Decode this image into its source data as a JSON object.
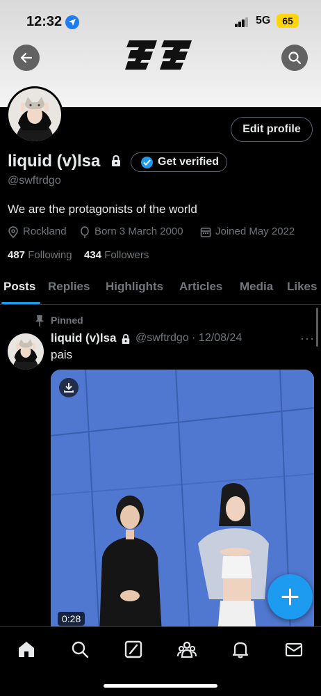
{
  "status_bar": {
    "time": "12:32",
    "network": "5G",
    "battery": "65"
  },
  "header": {
    "logo_text": "33",
    "back_icon": "arrow-left-icon",
    "search_icon": "search-icon"
  },
  "profile": {
    "name": "liquid (v)lsa",
    "handle": "@swftrdgo",
    "bio": "We are the protagonists of the world",
    "location": "Rockland",
    "birth": "Born 3 March 2000",
    "joined": "Joined May 2022",
    "following_count": "487",
    "following_label": "Following",
    "followers_count": "434",
    "followers_label": "Followers",
    "edit_label": "Edit profile",
    "verify_label": "Get verified"
  },
  "tabs": [
    {
      "label": "Posts",
      "active": true
    },
    {
      "label": "Replies"
    },
    {
      "label": "Highlights"
    },
    {
      "label": "Articles"
    },
    {
      "label": "Media"
    },
    {
      "label": "Likes"
    }
  ],
  "post": {
    "pinned_label": "Pinned",
    "name": "liquid (v)lsa",
    "handle_date": "@swftrdgo · 12/08/24",
    "text": "pais",
    "duration": "0:28",
    "more": "···"
  },
  "colors": {
    "accent": "#1d9bf0",
    "background": "#000000",
    "muted": "#71767b"
  },
  "bottom_nav": [
    "home-icon",
    "search-icon",
    "grok-icon",
    "communities-icon",
    "notifications-icon",
    "messages-icon"
  ]
}
